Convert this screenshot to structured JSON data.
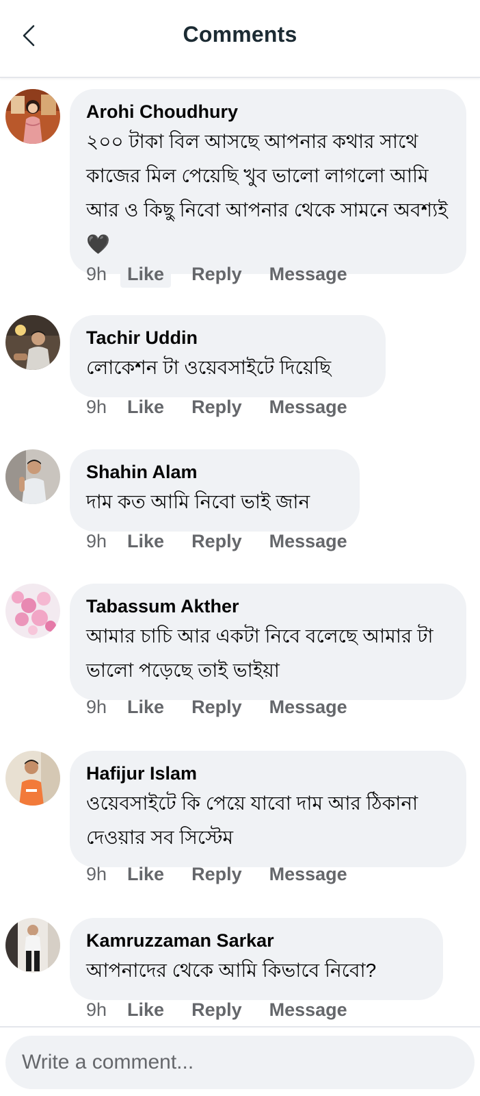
{
  "header": {
    "title": "Comments",
    "back_icon": "chevron-left-icon"
  },
  "comments": [
    {
      "author": "Arohi Choudhury",
      "text": "২০০ টাকা বিল আসছে আপনার কথার সাথে কাজের মিল পেয়েছি খুব ভালো লাগলো আমি আর ও কিছু নিবো আপনার থেকে সামনে অবশ্যই🖤",
      "time": "9h",
      "like": "Like",
      "reply": "Reply",
      "message": "Message"
    },
    {
      "author": "Tachir Uddin",
      "text": "লোকেশন টা ওয়েবসাইটে দিয়েছি",
      "time": "9h",
      "like": "Like",
      "reply": "Reply",
      "message": "Message"
    },
    {
      "author": "Shahin Alam",
      "text": "দাম কত আমি নিবো ভাই জান",
      "time": "9h",
      "like": "Like",
      "reply": "Reply",
      "message": "Message"
    },
    {
      "author": "Tabassum Akther",
      "text": "আমার চাচি আর একটা নিবে বলেছে আমার টা ভালো পড়েছে তাই ভাইয়া",
      "time": "9h",
      "like": "Like",
      "reply": "Reply",
      "message": "Message"
    },
    {
      "author": "Hafijur Islam",
      "text": "ওয়েবসাইটে কি পেয়ে যাবো দাম আর ঠিকানা দেওয়ার সব সিস্টেম",
      "time": "9h",
      "like": "Like",
      "reply": "Reply",
      "message": "Message"
    },
    {
      "author": "Kamruzzaman Sarkar",
      "text": "আপনাদের থেকে আমি কিভাবে নিবো?",
      "time": "9h",
      "like": "Like",
      "reply": "Reply",
      "message": "Message"
    }
  ],
  "composer": {
    "placeholder": "Write a comment..."
  },
  "colors": {
    "bubble": "#f0f2f5",
    "secondary_text": "#65676b",
    "title": "#1c2b33"
  }
}
